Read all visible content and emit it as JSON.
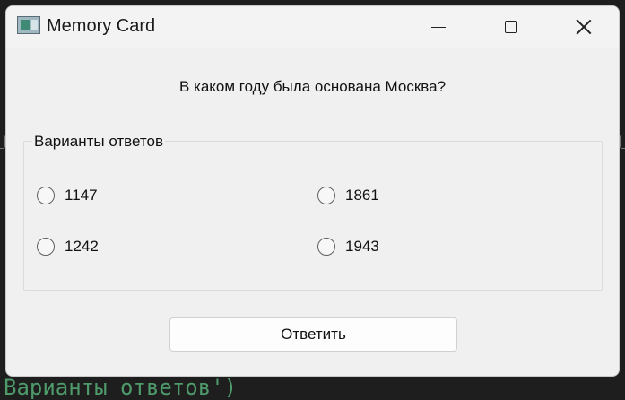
{
  "window": {
    "title": "Memory Card"
  },
  "background": {
    "code_text": "Варианты ответов')"
  },
  "question": {
    "text": "В каком году была основана Москва?"
  },
  "answers_group": {
    "title": "Варианты ответов",
    "options": [
      {
        "label": "1147",
        "selected": false
      },
      {
        "label": "1861",
        "selected": false
      },
      {
        "label": "1242",
        "selected": false
      },
      {
        "label": "1943",
        "selected": false
      }
    ]
  },
  "submit_button": {
    "label": "Ответить"
  },
  "icons": {
    "app": "app-icon",
    "minimize": "minimize-icon",
    "maximize": "maximize-icon",
    "close": "close-icon"
  }
}
